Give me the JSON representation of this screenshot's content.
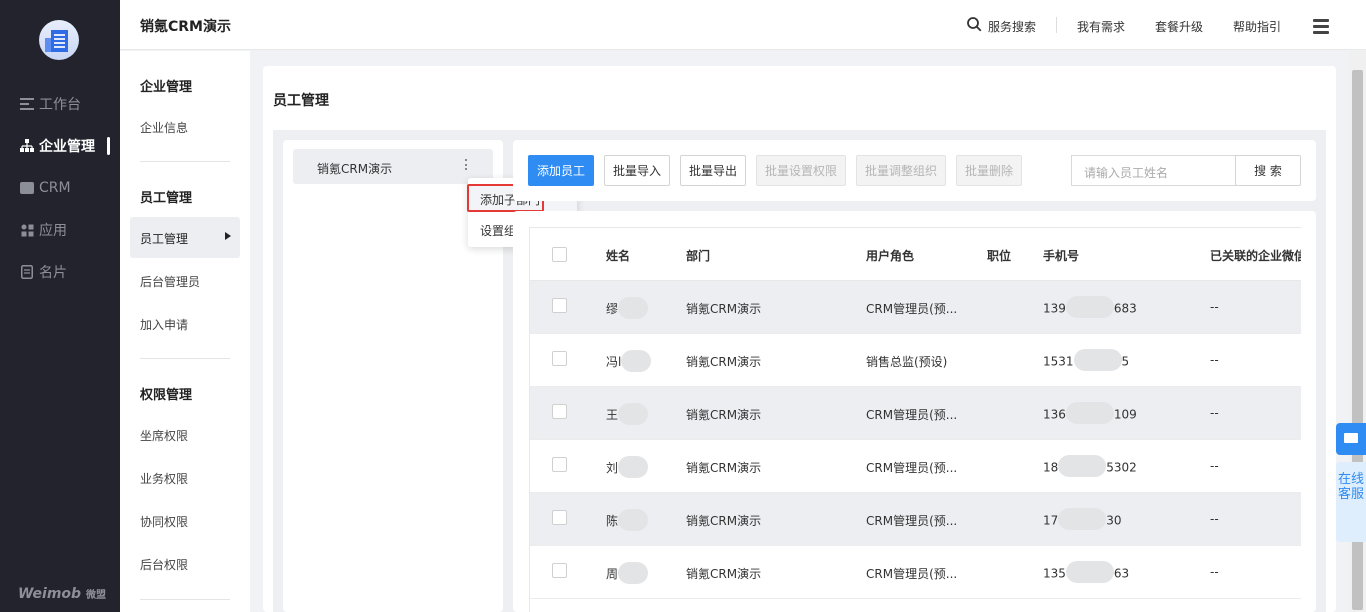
{
  "app": {
    "title": "销氪CRM演示",
    "brand": "Weimob",
    "brand_cn": "微盟"
  },
  "leftnav": {
    "items": [
      {
        "label": "工作台",
        "icon": "dashboard-icon",
        "active": false
      },
      {
        "label": "企业管理",
        "icon": "org-tree-icon",
        "active": true
      },
      {
        "label": "CRM",
        "icon": "crm-icon",
        "active": false
      },
      {
        "label": "应用",
        "icon": "apps-grid-icon",
        "active": false
      },
      {
        "label": "名片",
        "icon": "business-card-icon",
        "active": false
      }
    ]
  },
  "header": {
    "search_label": "服务搜索",
    "links": [
      "我有需求",
      "套餐升级",
      "帮助指引"
    ]
  },
  "submenu": {
    "groups": [
      {
        "title": "企业管理",
        "items": [
          "企业信息"
        ]
      },
      {
        "title": "员工管理",
        "items": [
          "员工管理",
          "后台管理员",
          "加入申请"
        ]
      },
      {
        "title": "权限管理",
        "items": [
          "坐席权限",
          "业务权限",
          "协同权限",
          "后台权限"
        ]
      }
    ],
    "active": "员工管理"
  },
  "page": {
    "title": "员工管理"
  },
  "tree": {
    "root": "销氪CRM演示",
    "menu": [
      "添加子部门",
      "设置组织负责人"
    ]
  },
  "toolbar": {
    "buttons": [
      {
        "label": "添加员工",
        "state": "primary"
      },
      {
        "label": "批量导入",
        "state": "normal"
      },
      {
        "label": "批量导出",
        "state": "normal"
      },
      {
        "label": "批量设置权限",
        "state": "disabled"
      },
      {
        "label": "批量调整组织",
        "state": "disabled"
      },
      {
        "label": "批量删除",
        "state": "disabled"
      }
    ],
    "search_placeholder": "请输入员工姓名",
    "search_button": "搜 索"
  },
  "table": {
    "columns": [
      "姓名",
      "部门",
      "用户角色",
      "职位",
      "手机号",
      "已关联的企业微信"
    ],
    "rows": [
      {
        "name": "缪",
        "dept": "销氪CRM演示",
        "role": "CRM管理员(预...",
        "position": "",
        "phone_pre": "139",
        "phone_post": "683",
        "wecom": "--"
      },
      {
        "name": "冯l",
        "dept": "销氪CRM演示",
        "role": "销售总监(预设)",
        "position": "",
        "phone_pre": "1531",
        "phone_post": "5",
        "wecom": "--"
      },
      {
        "name": "王",
        "dept": "销氪CRM演示",
        "role": "CRM管理员(预...",
        "position": "",
        "phone_pre": "136",
        "phone_post": "109",
        "wecom": "--"
      },
      {
        "name": "刘",
        "dept": "销氪CRM演示",
        "role": "CRM管理员(预...",
        "position": "",
        "phone_pre": "18",
        "phone_post": "5302",
        "wecom": "--"
      },
      {
        "name": "陈",
        "dept": "销氪CRM演示",
        "role": "CRM管理员(预...",
        "position": "",
        "phone_pre": "17",
        "phone_post": "30",
        "wecom": "--"
      },
      {
        "name": "周",
        "dept": "销氪CRM演示",
        "role": "CRM管理员(预...",
        "position": "",
        "phone_pre": "135",
        "phone_post": "63",
        "wecom": "--"
      }
    ]
  },
  "floating": {
    "online_service": "在线客服"
  },
  "colors": {
    "primary": "#2f8cf3",
    "sidebar_bg": "#22232c",
    "highlight_border": "#e53935"
  }
}
